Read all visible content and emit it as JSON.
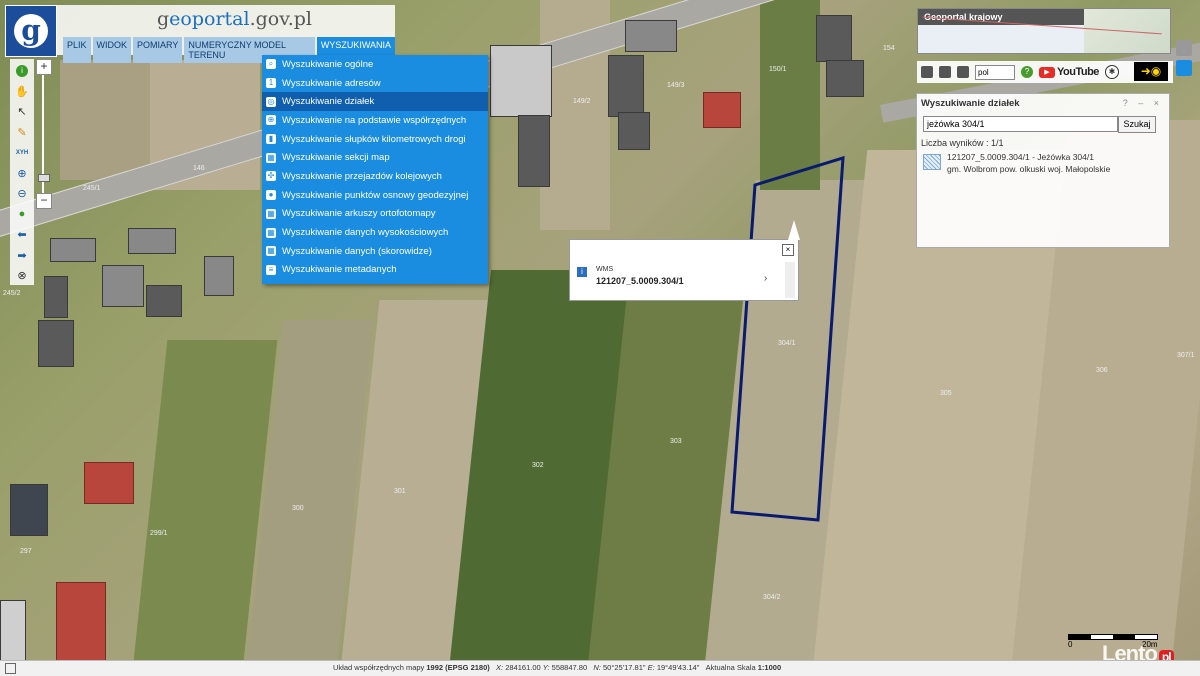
{
  "app": {
    "title_prefix": "g",
    "title_main": "eoportal",
    "title_suffix": ".gov.pl"
  },
  "menu": [
    {
      "label": "PLIK"
    },
    {
      "label": "WIDOK"
    },
    {
      "label": "POMIARY"
    },
    {
      "label": "NUMERYCZNY MODEL TERENU"
    },
    {
      "label": "WYSZUKIWANIA"
    }
  ],
  "dropdown": [
    {
      "label": "Wyszukiwanie ogólne",
      "icon": "search-icon"
    },
    {
      "label": "Wyszukiwanie adresów",
      "icon": "address-icon"
    },
    {
      "label": "Wyszukiwanie działek",
      "icon": "parcel-icon"
    },
    {
      "label": "Wyszukiwanie na podstawie współrzędnych",
      "icon": "coordinates-icon"
    },
    {
      "label": "Wyszukiwanie słupków kilometrowych drogi",
      "icon": "milestone-icon"
    },
    {
      "label": "Wyszukiwanie sekcji map",
      "icon": "map-section-icon"
    },
    {
      "label": "Wyszukiwanie przejazdów kolejowych",
      "icon": "railway-icon"
    },
    {
      "label": "Wyszukiwanie punktów osnowy geodezyjnej",
      "icon": "geodetic-point-icon"
    },
    {
      "label": "Wyszukiwanie arkuszy ortofotomapy",
      "icon": "orthophoto-icon"
    },
    {
      "label": "Wyszukiwanie danych wysokościowych",
      "icon": "elevation-icon"
    },
    {
      "label": "Wyszukiwanie danych (skorowidze)",
      "icon": "index-icon"
    },
    {
      "label": "Wyszukiwanie metadanych",
      "icon": "metadata-icon"
    }
  ],
  "toolbar": {
    "xyz_label": "XYH"
  },
  "popup": {
    "kind": "WMS",
    "parcel_id": "121207_5.0009.304/1"
  },
  "overview": {
    "title": "Geoportal krajowy"
  },
  "right_bar": {
    "lang": "pol",
    "youtube": "YouTube"
  },
  "parcel_search": {
    "title": "Wyszukiwanie działek",
    "controls": "? – ×",
    "query": "jeżówka 304/1",
    "button": "Szukaj",
    "count": "Liczba wyników : 1/1",
    "result_line1": "121207_5.0009.304/1 - Jeżówka 304/1",
    "result_line2": "gm. Wolbrom pow. olkuski woj. Małopolskie"
  },
  "parcels": [
    "146",
    "245/1",
    "149/2",
    "149/3",
    "150/1",
    "154",
    "245/2",
    "304/1",
    "305",
    "306",
    "307/1",
    "303",
    "302",
    "301",
    "300",
    "299/1",
    "297",
    "304/2"
  ],
  "status": {
    "crs_label": "Układ współrzędnych mapy",
    "crs_value": "1992 (EPSG 2180)",
    "x_label": "X:",
    "x_value": "284161.00",
    "y_label": "Y:",
    "y_value": "558847.80",
    "n_label": "N:",
    "n_value": "50°25'17.81\"",
    "e_label": "E:",
    "e_value": "19°49'43.14\"",
    "scale_label": "Aktualna Skala",
    "scale_value": "1:1000"
  },
  "scale_bar": {
    "left": "0",
    "right": "20m"
  },
  "watermark": {
    "text": "Lento",
    "suffix": "pl"
  },
  "colors": {
    "accent": "#1b8de0",
    "parcel_outline": "#0a1a6e"
  }
}
